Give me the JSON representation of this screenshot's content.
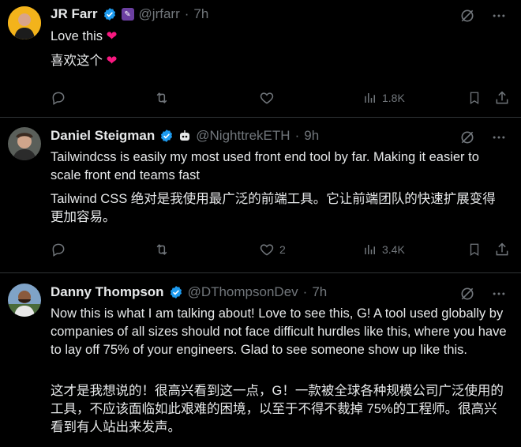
{
  "tweets": [
    {
      "name": "JR Farr",
      "handle": "@jrfarr",
      "dot": "·",
      "time": "7h",
      "text": "Love this",
      "text2": "喜欢这个",
      "views": "1.8K",
      "likes": ""
    },
    {
      "name": "Daniel Steigman",
      "handle": "@NighttrekETH",
      "dot": "·",
      "time": "9h",
      "text": "Tailwindcss is easily my most used front end tool by far. Making it easier to scale front end teams fast",
      "text2": "Tailwind CSS 绝对是我使用最广泛的前端工具。它让前端团队的快速扩展变得更加容易。",
      "views": "3.4K",
      "likes": "2"
    },
    {
      "name": "Danny Thompson",
      "handle": "@DThompsonDev",
      "dot": "·",
      "time": "7h",
      "text": "Now this is what I am talking about! Love to see this, G! A tool used globally by companies of all sizes should not face difficult hurdles like this, where you have to lay off 75% of your engineers. Glad to see someone show up like this.",
      "text2": "这才是我想说的！很高兴看到这一点，G！一款被全球各种规模公司广泛使用的工具，不应该面临如此艰难的困境，以至于不得不裁掉 75%的工程师。很高兴看到有人站出来发声。"
    }
  ],
  "colors": {
    "verified": "#1d9bf0",
    "heart": "#f91880",
    "muted": "#71767b"
  }
}
